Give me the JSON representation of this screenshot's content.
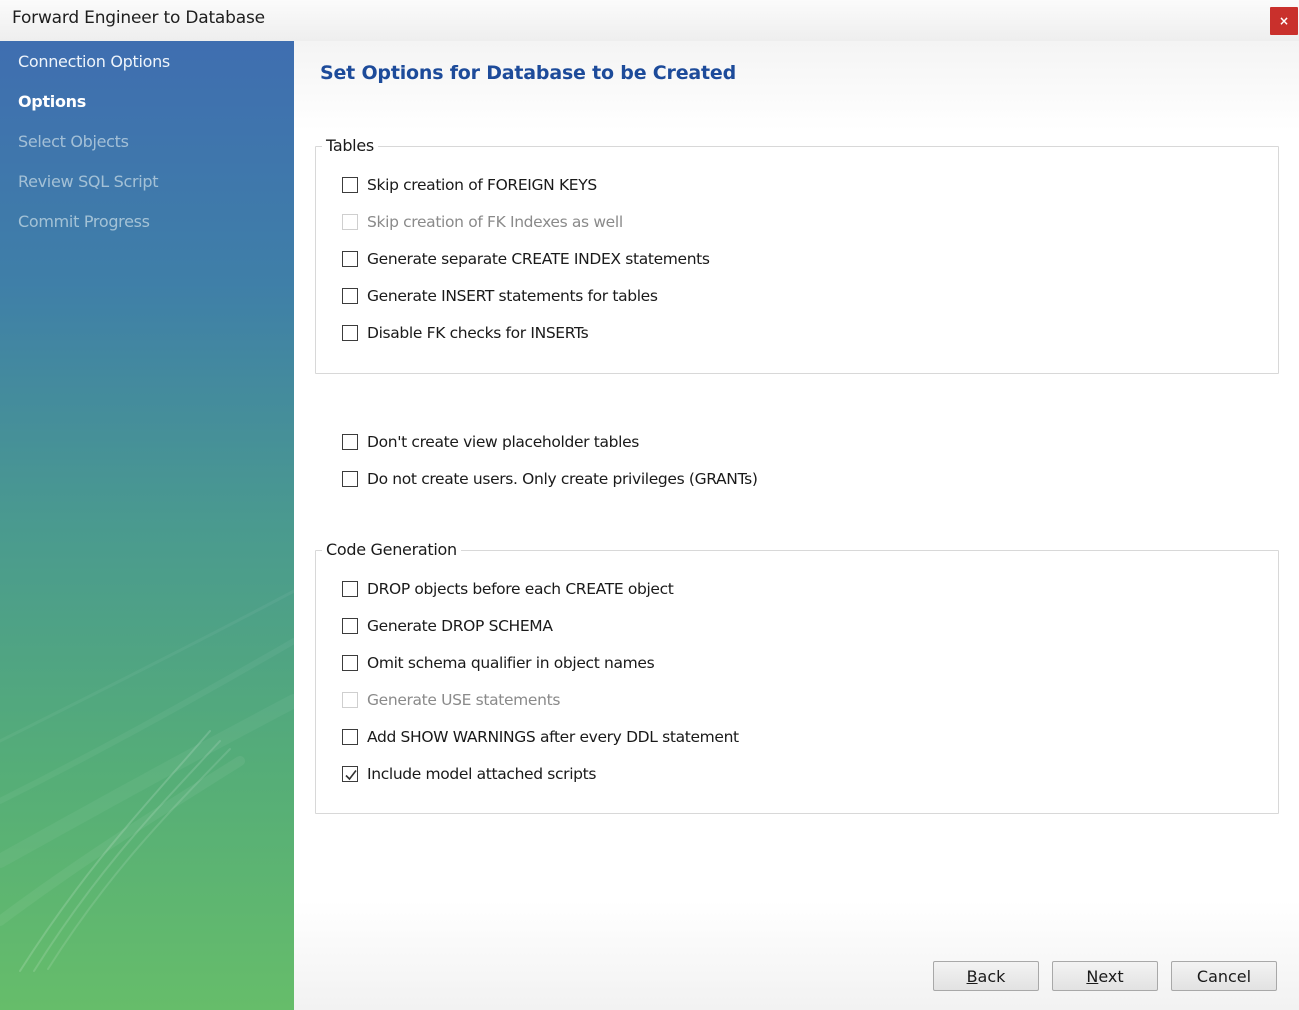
{
  "window": {
    "title": "Forward Engineer to Database",
    "close_glyph": "×"
  },
  "sidebar": {
    "items": [
      {
        "label": "Connection Options",
        "state": "done"
      },
      {
        "label": "Options",
        "state": "active"
      },
      {
        "label": "Select Objects",
        "state": "pending"
      },
      {
        "label": "Review SQL Script",
        "state": "pending"
      },
      {
        "label": "Commit Progress",
        "state": "pending"
      }
    ]
  },
  "main": {
    "title": "Set Options for Database to be Created",
    "tables_group": {
      "label": "Tables",
      "options": [
        {
          "label": "Skip creation of FOREIGN KEYS",
          "checked": false,
          "enabled": true
        },
        {
          "label": "Skip creation of FK Indexes as well",
          "checked": false,
          "enabled": false
        },
        {
          "label": "Generate separate CREATE INDEX statements",
          "checked": false,
          "enabled": true
        },
        {
          "label": "Generate INSERT statements for tables",
          "checked": false,
          "enabled": true
        },
        {
          "label": "Disable FK checks for INSERTs",
          "checked": false,
          "enabled": true
        }
      ]
    },
    "misc_options": [
      {
        "label": "Don't create view placeholder tables",
        "checked": false,
        "enabled": true
      },
      {
        "label": "Do not create users. Only create privileges (GRANTs)",
        "checked": false,
        "enabled": true
      }
    ],
    "codegen_group": {
      "label": "Code Generation",
      "options": [
        {
          "label": "DROP objects before each CREATE object",
          "checked": false,
          "enabled": true
        },
        {
          "label": "Generate DROP SCHEMA",
          "checked": false,
          "enabled": true
        },
        {
          "label": "Omit schema qualifier in object names",
          "checked": false,
          "enabled": true
        },
        {
          "label": "Generate USE statements",
          "checked": false,
          "enabled": false
        },
        {
          "label": "Add SHOW WARNINGS after every DDL statement",
          "checked": false,
          "enabled": true
        },
        {
          "label": "Include model attached scripts",
          "checked": true,
          "enabled": true
        }
      ]
    }
  },
  "buttons": {
    "back": {
      "mnemonic": "B",
      "rest": "ack"
    },
    "next": {
      "mnemonic": "N",
      "rest": "ext"
    },
    "cancel": {
      "label": "Cancel"
    }
  },
  "colors": {
    "title_accent": "#1d4b9a",
    "sidebar_top": "#3f6eb0",
    "sidebar_bottom": "#66bd6a",
    "close_button": "#c9302c"
  }
}
